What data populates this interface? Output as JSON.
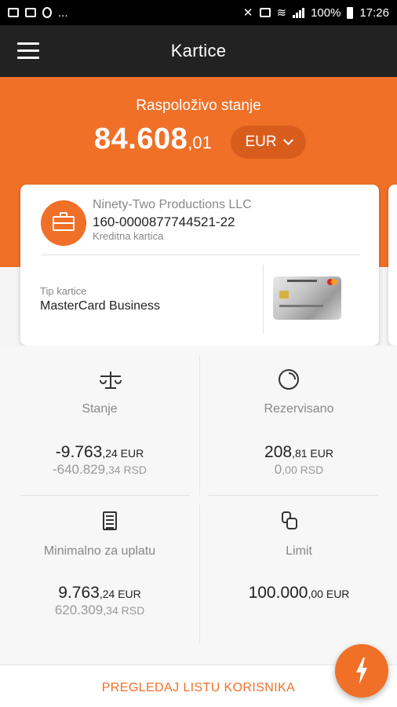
{
  "statusbar": {
    "dots": "...",
    "battery": "100%",
    "time": "17:26"
  },
  "appbar": {
    "title": "Kartice"
  },
  "balance": {
    "label": "Raspoloživo stanje",
    "amount_main": "84.608",
    "amount_decimals": ",01",
    "currency": "EUR"
  },
  "card": {
    "holder": "Ninety-Two Productions LLC",
    "number": "160-0000877744521-22",
    "kind": "Kreditna kartica",
    "type_label": "Tip kartice",
    "type_value": "MasterCard Business"
  },
  "stats": {
    "stanje": {
      "label": "Stanje",
      "main": "-9.763",
      "main_dec": ",24",
      "main_cur": " EUR",
      "sub": "-640.829",
      "sub_dec": ",34",
      "sub_cur": " RSD"
    },
    "rezervisano": {
      "label": "Rezervisano",
      "main": "208",
      "main_dec": ",81",
      "main_cur": " EUR",
      "sub": "0",
      "sub_dec": ",00",
      "sub_cur": " RSD"
    },
    "minimalno": {
      "label": "Minimalno za uplatu",
      "main": "9.763",
      "main_dec": ",24",
      "main_cur": " EUR",
      "sub": "620.309",
      "sub_dec": ",34",
      "sub_cur": " RSD"
    },
    "limit": {
      "label": "Limit",
      "main": "100.000",
      "main_dec": ",00",
      "main_cur": " EUR"
    }
  },
  "footer": {
    "action_label": "PREGLEDAJ LISTU KORISNIKA"
  },
  "icons": {
    "menu": "menu-icon",
    "briefcase": "briefcase-icon",
    "scale": "scale-icon",
    "clock": "clock-icon",
    "document": "document-icon",
    "coins": "coins-icon",
    "bolt": "lightning-icon"
  },
  "colors": {
    "accent": "#f07028",
    "appbar": "#222222",
    "statusbar": "#000000"
  }
}
